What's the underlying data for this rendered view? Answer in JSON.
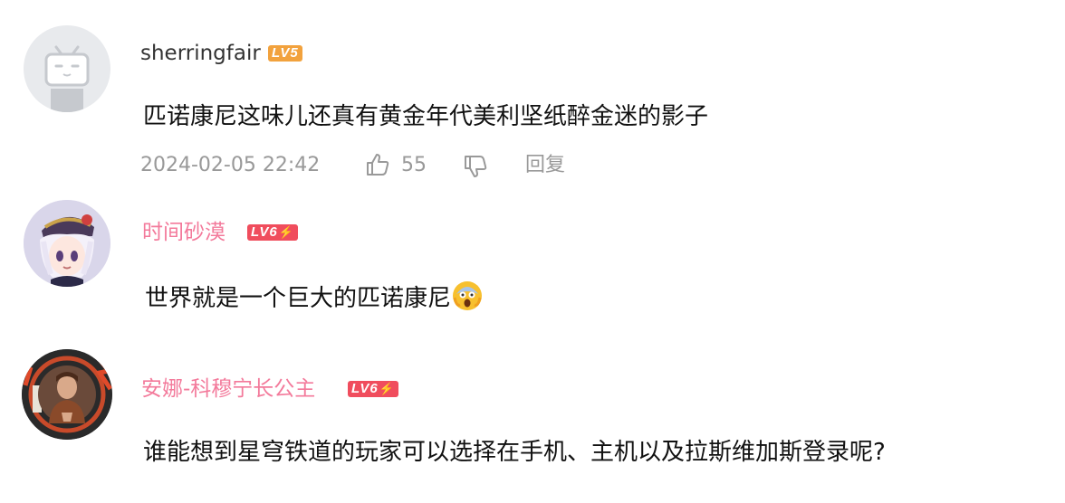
{
  "comments": [
    {
      "username": "sherringfair",
      "level": "LV5",
      "text": "匹诺康尼这味儿还真有黄金年代美利坚纸醉金迷的影子",
      "timestamp": "2024-02-05 22:42",
      "like_count": "55",
      "reply_label": "回复",
      "name_color": "#333333"
    },
    {
      "username": "时间砂漠",
      "level": "LV6",
      "text": "世界就是一个巨大的匹诺康尼",
      "emoji": "scream-emoji",
      "name_color": "#f37a9b"
    },
    {
      "username": "安娜-科穆宁长公主",
      "level": "LV6",
      "text": "谁能想到星穹铁道的玩家可以选择在手机、主机以及拉斯维加斯登录呢?",
      "name_color": "#f37a9b"
    }
  ]
}
